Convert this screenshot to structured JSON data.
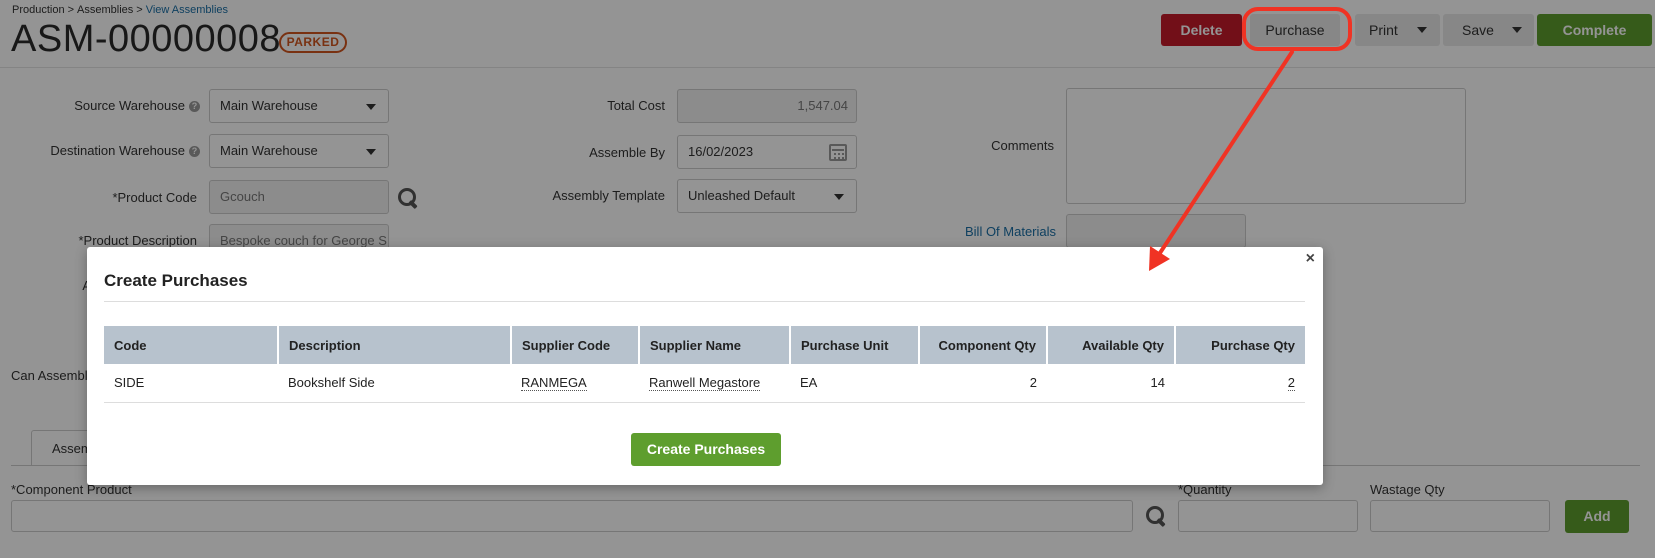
{
  "breadcrumb": {
    "items": [
      "Production",
      "Assemblies"
    ],
    "current": "View Assemblies",
    "separator": ">"
  },
  "title": "ASM-00000008",
  "status_badge": "PARKED",
  "toolbar": {
    "delete": "Delete",
    "purchase": "Purchase",
    "print": "Print",
    "save": "Save",
    "complete": "Complete"
  },
  "form": {
    "source_warehouse": {
      "label": "Source Warehouse",
      "value": "Main Warehouse"
    },
    "destination_warehouse": {
      "label": "Destination Warehouse",
      "value": "Main Warehouse"
    },
    "product_code": {
      "label": "*Product Code",
      "value": "Gcouch"
    },
    "product_description": {
      "label": "*Product Description",
      "value": "Bespoke couch for George S"
    },
    "total_cost": {
      "label": "Total Cost",
      "value": "1,547.04"
    },
    "assemble_by": {
      "label": "Assemble By",
      "value": "16/02/2023"
    },
    "assembly_template": {
      "label": "Assembly Template",
      "value": "Unleashed Default"
    },
    "comments": {
      "label": "Comments",
      "value": ""
    },
    "bill_of_materials": {
      "label": "Bill Of Materials"
    },
    "partial_label_a": "A",
    "can_assemble_label": "Can Assembl"
  },
  "tab": {
    "label": "Assem"
  },
  "component": {
    "product_label": "*Component Product",
    "quantity_label": "*Quantity",
    "wastage_label": "Wastage Qty",
    "add_button": "Add"
  },
  "modal": {
    "title": "Create Purchases",
    "close": "×",
    "columns": [
      "Code",
      "Description",
      "Supplier Code",
      "Supplier Name",
      "Purchase Unit",
      "Component Qty",
      "Available Qty",
      "Purchase Qty"
    ],
    "rows": [
      {
        "code": "SIDE",
        "description": "Bookshelf Side",
        "supplier_code": "RANMEGA",
        "supplier_name": "Ranwell Megastore",
        "purchase_unit": "EA",
        "component_qty": "2",
        "available_qty": "14",
        "purchase_qty": "2"
      }
    ],
    "create_button": "Create Purchases"
  },
  "colors": {
    "danger": "#c41a2a",
    "success": "#5e9e2e",
    "link": "#1a6fa6",
    "badge": "#d0551e",
    "annotation": "#f03324",
    "table_header": "#b7c2cd"
  }
}
